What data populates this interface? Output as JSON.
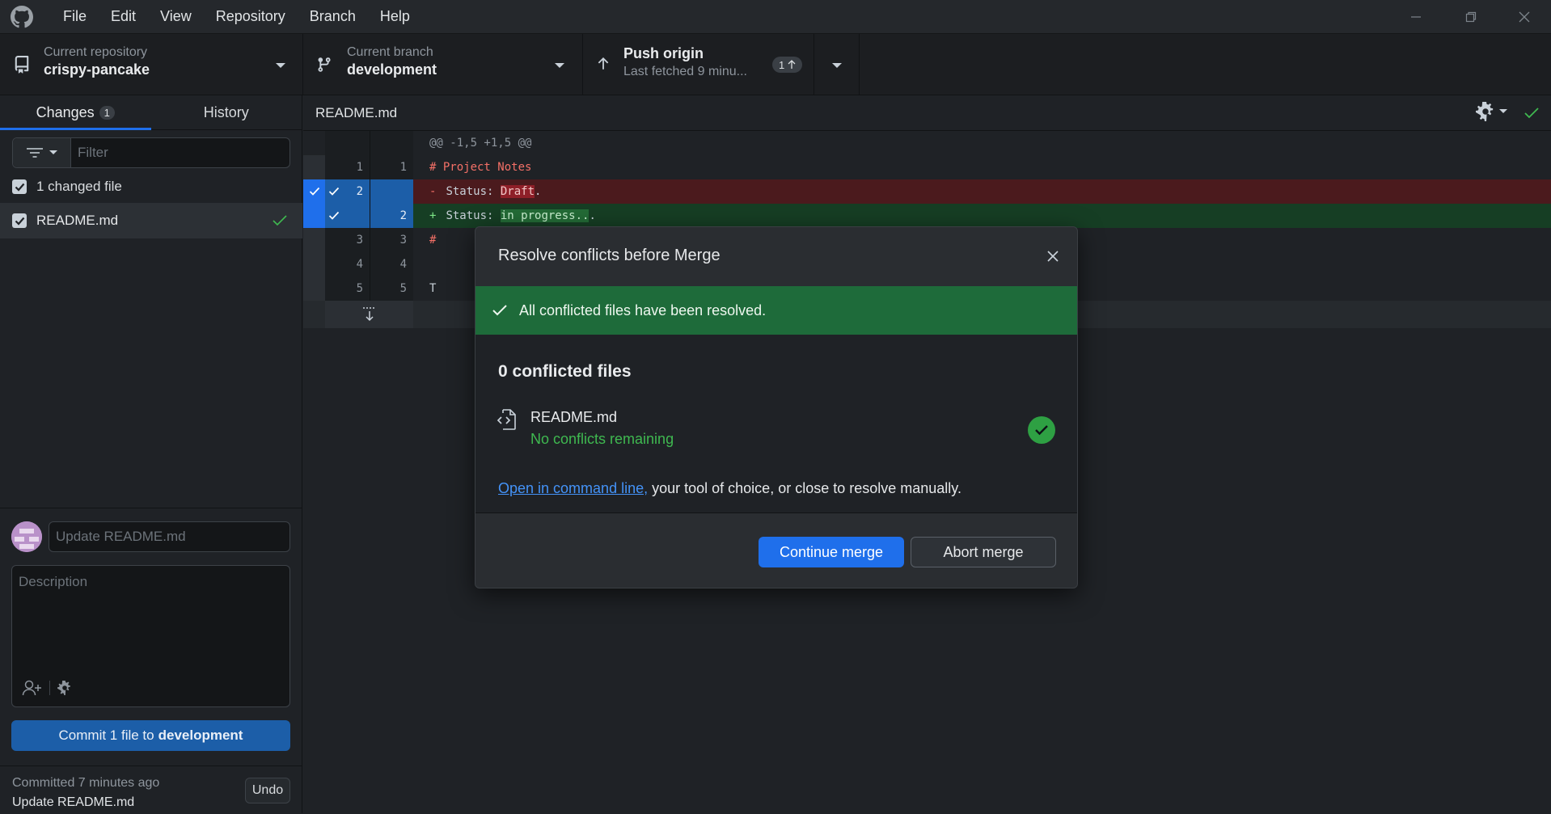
{
  "colors": {
    "accent": "#1f6feb",
    "success": "#2ea043",
    "deleted_bg": "#4b1a1d",
    "added_bg": "#163e24",
    "banner_bg": "#1e6b3a"
  },
  "menu": [
    "File",
    "Edit",
    "View",
    "Repository",
    "Branch",
    "Help"
  ],
  "toolbar": {
    "repo_label": "Current repository",
    "repo_value": "crispy-pancake",
    "branch_label": "Current branch",
    "branch_value": "development",
    "push_label": "Push origin",
    "push_sub": "Last fetched 9 minu...",
    "push_badge": "1"
  },
  "sidebar": {
    "tab_changes": "Changes",
    "tab_changes_count": "1",
    "tab_history": "History",
    "filter_placeholder": "Filter",
    "changed_files": "1 changed file",
    "file_name": "README.md"
  },
  "commit": {
    "summary_placeholder": "Update README.md",
    "description_placeholder": "Description",
    "button_prefix": "Commit 1 file to",
    "button_branch": "development",
    "last_time": "Committed 7 minutes ago",
    "last_summary": "Update README.md",
    "undo": "Undo"
  },
  "diff": {
    "file_name": "README.md",
    "hunk": "@@ -1,5 +1,5 @@",
    "lines": [
      {
        "old": "1",
        "new": "1",
        "marker": "",
        "code_a": "# Project Notes",
        "hl": "",
        "code_b": ""
      },
      {
        "old": "2",
        "new": "",
        "marker": "-",
        "code_a": "Status: ",
        "hl": "Draft",
        "code_b": "."
      },
      {
        "old": "",
        "new": "2",
        "marker": "+",
        "code_a": "Status: ",
        "hl": "in progress..",
        "code_b": "."
      },
      {
        "old": "3",
        "new": "3",
        "marker": "",
        "code_a": "#",
        "hl": "",
        "code_b": ""
      },
      {
        "old": "4",
        "new": "4",
        "marker": "",
        "code_a": "",
        "hl": "",
        "code_b": ""
      },
      {
        "old": "5",
        "new": "5",
        "marker": "",
        "code_a": "T",
        "hl": "",
        "code_b": ""
      }
    ]
  },
  "modal": {
    "title": "Resolve conflicts before Merge",
    "banner": "All conflicted files have been resolved.",
    "heading": "0 conflicted files",
    "file_name": "README.md",
    "file_status": "No conflicts remaining",
    "cmd_link": "Open in command line,",
    "cmd_rest": " your tool of choice, or close to resolve manually.",
    "continue": "Continue merge",
    "abort": "Abort merge"
  }
}
